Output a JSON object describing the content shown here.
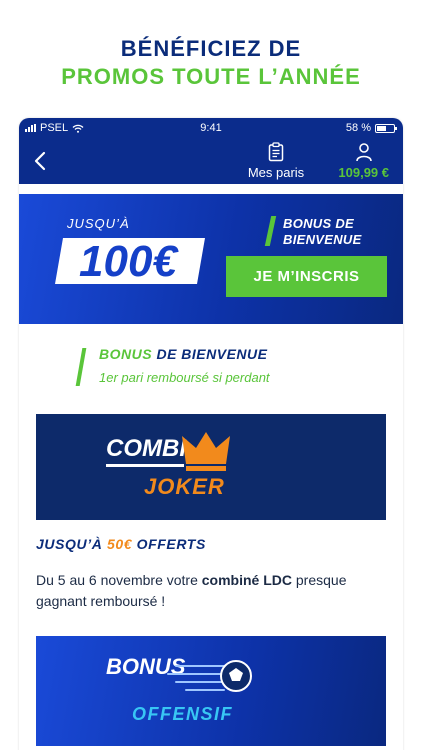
{
  "headline": {
    "line1": "BÉNÉFICIEZ DE",
    "line2": "PROMOS TOUTE L’ANNÉE"
  },
  "status_bar": {
    "carrier": "PSEL",
    "time": "9:41",
    "battery": "58 %",
    "battery_level": 0.58
  },
  "nav": {
    "back_icon": "chevron-left-icon",
    "bets_label": "Mes paris",
    "bets_icon": "clipboard-icon",
    "account_icon": "user-icon",
    "balance": "109,99 €"
  },
  "banner": {
    "upto": "JUSQU’À",
    "amount": "100€",
    "bonus_line1": "BONUS DE",
    "bonus_line2": "BIENVENUE",
    "cta": "JE M’INSCRIS"
  },
  "welcome": {
    "title_accent": "BONUS",
    "title_rest": "DE BIENVENUE",
    "subtitle": "1er pari remboursé si perdant"
  },
  "combi_card": {
    "word1": "COMBI",
    "word2": "JOKER",
    "icon": "crown-icon"
  },
  "offer": {
    "prefix": "JUSQU’À",
    "amount": "50€",
    "suffix": "OFFERTS",
    "desc_before": "Du 5 au 6 novembre votre ",
    "desc_bold": "combiné LDC",
    "desc_after": " presque gagnant remboursé !"
  },
  "offensif_card": {
    "word1": "BONUS",
    "word2": "OFFENSIF",
    "icon": "soccer-ball-icon"
  },
  "colors": {
    "brand_blue": "#0b2c8c",
    "green": "#5ac53a",
    "orange": "#f28a1c",
    "navy": "#0b2c7a"
  }
}
